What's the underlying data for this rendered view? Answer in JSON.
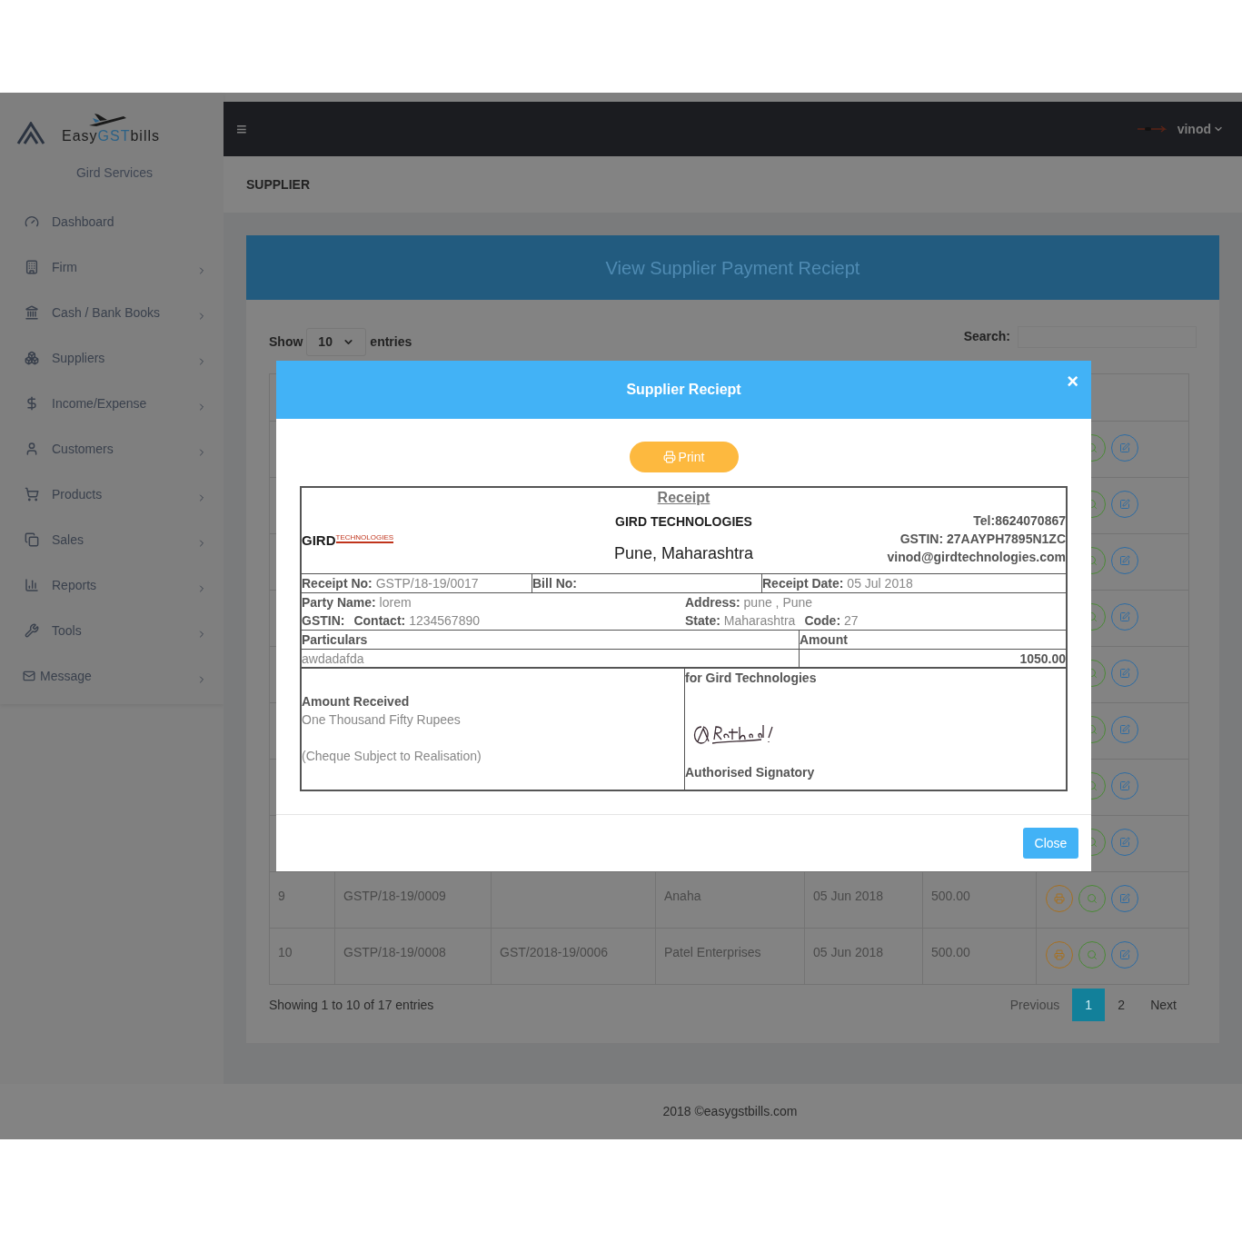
{
  "brand": {
    "parts": [
      "Easy",
      "GST",
      "bills"
    ],
    "company": "Gird Services"
  },
  "sidebar": {
    "items": [
      {
        "label": "Dashboard",
        "expandable": false
      },
      {
        "label": "Firm",
        "expandable": true
      },
      {
        "label": "Cash / Bank Books",
        "expandable": true
      },
      {
        "label": "Suppliers",
        "expandable": true
      },
      {
        "label": "Income/Expense",
        "expandable": true
      },
      {
        "label": "Customers",
        "expandable": true
      },
      {
        "label": "Products",
        "expandable": true
      },
      {
        "label": "Sales",
        "expandable": true
      },
      {
        "label": "Reports",
        "expandable": true
      },
      {
        "label": "Tools",
        "expandable": true
      },
      {
        "label": "Message",
        "expandable": true
      }
    ]
  },
  "topbar": {
    "menu": "≡",
    "user": "vinod"
  },
  "page_title": "SUPPLIER",
  "card": {
    "title": "View Supplier Payment Reciept",
    "show": {
      "label": "Show",
      "value": "10",
      "suffix": "entries"
    },
    "search": {
      "label": "Search:"
    },
    "rows": [
      {
        "covered": true
      },
      {
        "covered": true
      },
      {
        "covered": true
      },
      {
        "covered": true
      },
      {
        "covered": true
      },
      {
        "covered": true
      },
      {
        "covered": true
      },
      {
        "covered": true
      },
      {
        "covered": false,
        "cells": [
          "9",
          "GSTP/18-19/0009",
          "",
          "Anaha",
          "05 Jun 2018",
          "500.00"
        ]
      },
      {
        "covered": false,
        "cells": [
          "10",
          "GSTP/18-19/0008",
          "GST/2018-19/0006",
          "Patel Enterprises",
          "05 Jun 2018",
          "500.00"
        ]
      }
    ],
    "info": "Showing 1 to 10 of 17 entries",
    "pagination": {
      "previous": "Previous",
      "next": "Next",
      "pages": [
        {
          "label": "1",
          "selected": true
        },
        {
          "label": "2",
          "selected": false
        }
      ]
    }
  },
  "dialog": {
    "title": "Supplier Reciept",
    "close_x": "×",
    "print": "Print",
    "close": "Close",
    "receipt": {
      "title": "Receipt",
      "company": "GIRD TECHNOLOGIES",
      "city": "Pune, Maharashtra",
      "logo": {
        "word": "GIRD",
        "tag": "TECHNOLOGIES"
      },
      "contact": [
        "Tel:8624070867",
        "GSTIN: 27AAYPH7895N1ZC",
        "vinod@girdtechnologies.com"
      ],
      "receipt_no": {
        "label": "Receipt No:",
        "value": "GSTP/18-19/0017"
      },
      "bill_no": {
        "label": "Bill No:"
      },
      "receipt_date": {
        "label": "Receipt Date:",
        "value": "05 Jul 2018"
      },
      "party_name": {
        "label": "Party Name:",
        "value": "lorem"
      },
      "address": {
        "label": "Address:",
        "value": "pune , Pune"
      },
      "gstin": {
        "label": "GSTIN:"
      },
      "contact_no": {
        "label": "Contact:",
        "value": "1234567890"
      },
      "state": {
        "label": "State:",
        "value": "Maharashtra"
      },
      "code": {
        "label": "Code:",
        "value": "27"
      },
      "particulars_header": "Particulars",
      "amount_header": "Amount",
      "items": [
        {
          "particular": "awdadafda",
          "amount": "1050.00"
        }
      ],
      "amount_received": "Amount Received",
      "amount_words": "One Thousand Fifty Rupees",
      "cheque_note": "(Cheque Subject to Realisation)",
      "for_company": "for Gird Technologies",
      "signatory": "Authorised Signatory"
    }
  },
  "footer": "2018 ©easygstbills.com"
}
